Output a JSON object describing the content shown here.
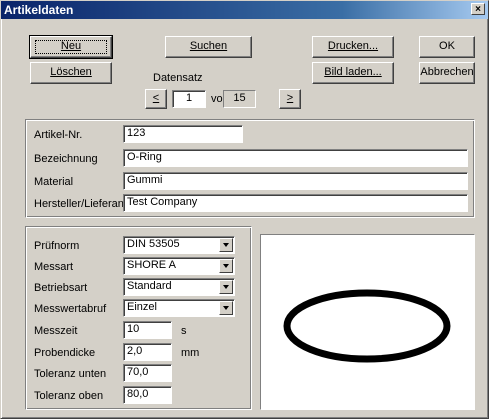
{
  "window": {
    "title": "Artikeldaten",
    "close_glyph": "×"
  },
  "buttons": {
    "neu": "Neu",
    "suchen": "Suchen",
    "drucken": "Drucken...",
    "ok": "OK",
    "loeschen": "Löschen",
    "bild_laden": "Bild laden...",
    "abbrechen": "Abbrechen",
    "prev": "<",
    "next": ">"
  },
  "record": {
    "label": "Datensatz",
    "current": "1",
    "of_label": "von",
    "total": "15"
  },
  "article": {
    "artikel_nr": {
      "label": "Artikel-Nr.",
      "value": "123"
    },
    "bezeichnung": {
      "label": "Bezeichnung",
      "value": "O-Ring"
    },
    "material": {
      "label": "Material",
      "value": "Gummi"
    },
    "hersteller": {
      "label": "Hersteller/Lieferant",
      "value": "Test Company"
    }
  },
  "test": {
    "pruefnorm": {
      "label": "Prüfnorm",
      "value": "DIN 53505"
    },
    "messart": {
      "label": "Messart",
      "value": "SHORE A"
    },
    "betriebsart": {
      "label": "Betriebsart",
      "value": "Standard"
    },
    "messwertabruf": {
      "label": "Messwertabruf",
      "value": "Einzel"
    },
    "messzeit": {
      "label": "Messzeit",
      "value": "10",
      "unit": "s"
    },
    "probendicke": {
      "label": "Probendicke",
      "value": "2,0",
      "unit": "mm"
    },
    "toleranz_unten": {
      "label": "Toleranz unten",
      "value": "70,0"
    },
    "toleranz_oben": {
      "label": "Toleranz oben",
      "value": "80,0"
    }
  },
  "image": {
    "icon": "o-ring-image"
  }
}
